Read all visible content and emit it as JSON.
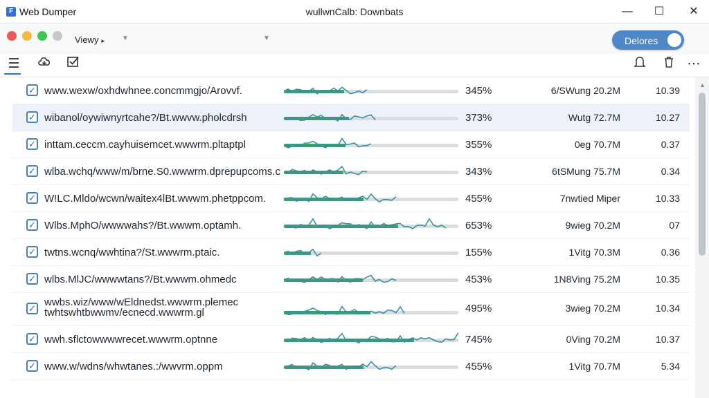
{
  "app": {
    "title": "Web Dumper",
    "window_title": "wullwnCalb: Downbats",
    "minimize": "—",
    "maximize": "☐",
    "close": "✕"
  },
  "toolbar": {
    "view_label": "Viewy",
    "view_caret": "▸",
    "toggle_label": "Delores",
    "toggle_on": true,
    "accent": "#4f86c6",
    "dots": [
      "#ec5b56",
      "#f5b940",
      "#3fc551",
      "#c8c8c8"
    ]
  },
  "icons": [
    "menu-icon",
    "cloud-icon",
    "checkbox-icon",
    "bell-icon",
    "trash-icon",
    "more-icon"
  ],
  "rows": [
    {
      "url": "www.wexw/oxhdwhnee.concmmgjo/Arovvf.",
      "progress": 34.5,
      "percent": "345%",
      "size": "6/SWung 20.2M",
      "speed": "10.39",
      "checked": true
    },
    {
      "url": "wibanol/oywiwnyrtcahe?/Bt.wwvw.pholcdrsh",
      "progress": 37.3,
      "percent": "373%",
      "size": "Wutg 72.7M",
      "speed": "10.27",
      "checked": true,
      "selected": true
    },
    {
      "url": "inttam.ceccm.cayhuisemcet.wwwrm.pltaptpl",
      "progress": 35.5,
      "percent": "355%",
      "size": "0eg 70.7M",
      "speed": "0.37",
      "checked": true
    },
    {
      "url": "wlba.wchq/www/m/brne.S0.wwwrm.dprepupcoms.c",
      "progress": 34.3,
      "percent": "343%",
      "size": "6tSMung 75.7M",
      "speed": "0.34",
      "checked": true
    },
    {
      "url": "W!LC.Mldo/wcwn/waitex4lBt.wwwm.phetppcom.",
      "progress": 45.5,
      "percent": "455%",
      "size": "7nwtied Miper",
      "speed": "10.33",
      "checked": true
    },
    {
      "url": "Wlbs.MphO/wwwwahs?/Bt.wwwm.optamh.",
      "progress": 65.3,
      "percent": "653%",
      "size": "9wieg 70.2M",
      "speed": "07",
      "checked": true
    },
    {
      "url": "twtns.wcnq/wwhtina?/St.wwwrm.ptaic.",
      "progress": 15.5,
      "percent": "155%",
      "size": "1Vitg 70.3M",
      "speed": "0.36",
      "checked": true
    },
    {
      "url": "wlbs.MlJC/wwwwtans?/Bt.wwwm.ohmedc",
      "progress": 45.3,
      "percent": "453%",
      "size": "1N8Ving 75.2M",
      "speed": "10.35",
      "checked": true
    },
    {
      "url": "wwbs.wiz/www/wEldnedst.wwwrm.plemec",
      "url2": "twhtswhtbwwmv/ecnecd.wwwrm.gl",
      "progress": 49.5,
      "percent": "495%",
      "size": "3wieg 70.2M",
      "speed": "10.34",
      "checked": true,
      "tall": true
    },
    {
      "url": "wwh.sflctowwwwrecet.wwwrm.optnne",
      "progress": 74.5,
      "percent": "745%",
      "size": "0Ving 70.2M",
      "speed": "10.37",
      "checked": true
    },
    {
      "url": "www.w/wdns/whwtanes.:/wwvrm.oppm",
      "progress": 45.5,
      "percent": "455%",
      "size": "1Vitg 70.7M",
      "speed": "5.34",
      "checked": true
    }
  ]
}
